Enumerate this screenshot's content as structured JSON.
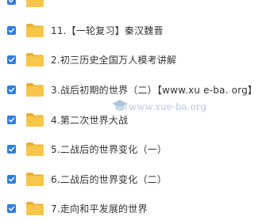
{
  "rows": [
    {
      "name": "",
      "checked": true
    },
    {
      "name": "11.【一轮复习】秦汉魏晋",
      "checked": true
    },
    {
      "name": "2.初三历史全国万人模考讲解",
      "checked": true
    },
    {
      "name": "3.战后初期的世界（二）【www.xu e-ba. org】",
      "checked": true
    },
    {
      "name": "4.第二次世界大战",
      "checked": true
    },
    {
      "name": "5.二战后的世界变化（一）",
      "checked": true
    },
    {
      "name": "6.二战后的世界变化（二）",
      "checked": true
    },
    {
      "name": "7.走向和平发展的世界",
      "checked": true
    }
  ],
  "watermark": {
    "text": "www.xue-ba.org",
    "icon": "graduation-cap-icon"
  },
  "colors": {
    "checkbox": "#2f7de1",
    "folder": "#f7c64a",
    "folder_tab": "#eab130",
    "text": "#333333"
  }
}
